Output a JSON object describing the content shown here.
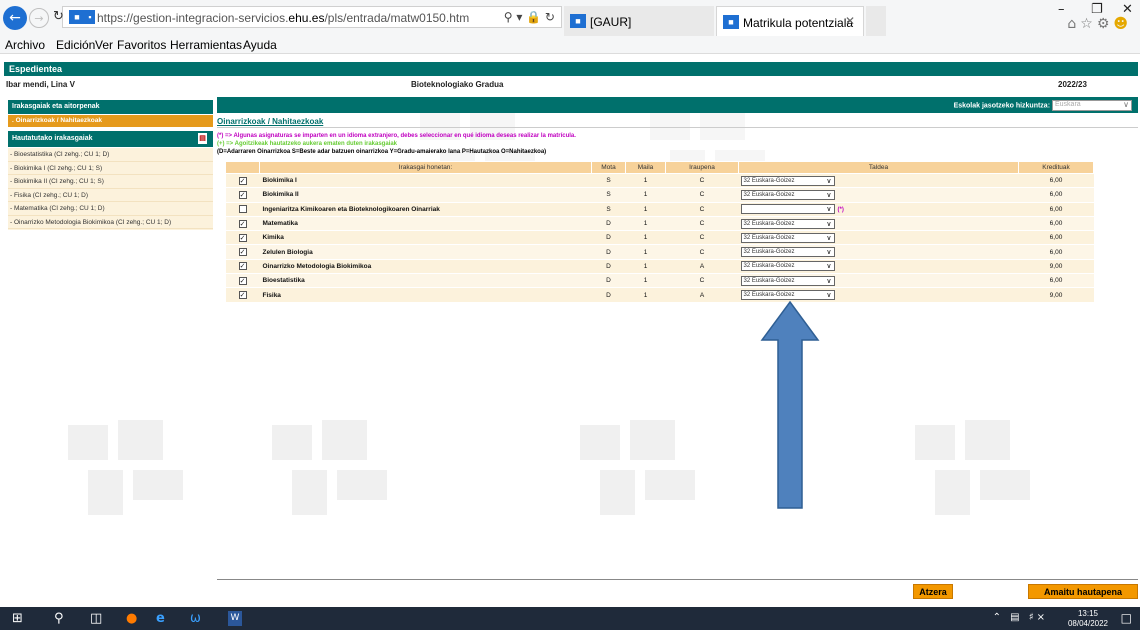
{
  "browser": {
    "url_prefix": "https://gestion-integracion-servicios.",
    "url_domain": "ehu.es",
    "url_suffix": "/pls/entrada/matw0150.htm",
    "tabs": [
      {
        "label": "[GAUR]"
      },
      {
        "label": "Matrikula potentziala"
      }
    ],
    "menu": [
      "Archivo",
      "Edición",
      "Ver",
      "Favoritos",
      "Herramientas",
      "Ayuda"
    ]
  },
  "header": {
    "title": "Espedientea",
    "student_name": "Ibar mendi, Lina V",
    "degree": "Bioteknologiako Gradua",
    "year": "2022/23"
  },
  "sidebar": {
    "section1_title": "Irakasgaiak eta aitorpenak",
    "active_item": ". Oinarrizkoak / Nahitaezkoak",
    "section2_title": "Hautatutako irakasgaiak",
    "items": [
      "- Bioestatistika (CI zehg.; CU 1; D)",
      "- Biokimika I (CI zehg.; CU 1; S)",
      "- Biokimika II (CI zehg.; CU 1; S)",
      "- Fisika (CI zehg.; CU 1; D)",
      "- Matematika (CI zehg.; CU 1; D)",
      "- Oinarrizko Metodologia Biokimikoa (CI zehg.; CU 1; D)"
    ]
  },
  "main": {
    "lang_label": "Eskolak jasotzeko hizkuntza:",
    "lang_value": "Euskara",
    "section_title": "Oinarrizkoak / Nahitaezkoak",
    "note1": "(*) => Algunas asignaturas se imparten en un idioma extranjero, debes seleccionar en qué idioma deseas realizar la matrícula.",
    "note2": "(+) => Agoitzikeak hautatzeko aukera ematen duten irakasgaiak",
    "note3": "(D=Adarraren Oinarrizkoa S=Beste adar batzuen oinarrizkoa Y=Gradu-amaierako lana P=Hautazkoa O=Nahitaezkoa)",
    "columns": [
      "Irakasgai honetan:",
      "Mota",
      "Maila",
      "Iraupena",
      "Taldea",
      "Kredituak"
    ],
    "rows": [
      {
        "checked": true,
        "name": "Biokimika I",
        "mota": "S",
        "maila": "1",
        "iraupena": "C",
        "taldea": "32 Euskara-Goizez",
        "kredituak": "6,00"
      },
      {
        "checked": true,
        "name": "Biokimika II",
        "mota": "S",
        "maila": "1",
        "iraupena": "C",
        "taldea": "32 Euskara-Goizez",
        "kredituak": "6,00"
      },
      {
        "checked": false,
        "name": "Ingeniaritza Kimikoaren eta Bioteknologikoaren Oinarriak",
        "mota": "S",
        "maila": "1",
        "iraupena": "C",
        "taldea": "",
        "kredituak": "6,00",
        "note": "(*)"
      },
      {
        "checked": true,
        "name": "Matematika",
        "mota": "D",
        "maila": "1",
        "iraupena": "C",
        "taldea": "32 Euskara-Goizez",
        "kredituak": "6,00"
      },
      {
        "checked": true,
        "name": "Kimika",
        "mota": "D",
        "maila": "1",
        "iraupena": "C",
        "taldea": "32 Euskara-Goizez",
        "kredituak": "6,00"
      },
      {
        "checked": true,
        "name": "Zelulen Biologia",
        "mota": "D",
        "maila": "1",
        "iraupena": "C",
        "taldea": "32 Euskara-Goizez",
        "kredituak": "6,00"
      },
      {
        "checked": true,
        "name": "Oinarrizko Metodologia Biokimikoa",
        "mota": "D",
        "maila": "1",
        "iraupena": "A",
        "taldea": "32 Euskara-Goizez",
        "kredituak": "9,00"
      },
      {
        "checked": true,
        "name": "Bioestatistika",
        "mota": "D",
        "maila": "1",
        "iraupena": "C",
        "taldea": "32 Euskara-Goizez",
        "kredituak": "6,00"
      },
      {
        "checked": true,
        "name": "Fisika",
        "mota": "D",
        "maila": "1",
        "iraupena": "A",
        "taldea": "32 Euskara-Goizez",
        "kredituak": "9,00"
      }
    ],
    "btn_back": "Atzera",
    "btn_finish": "Amaitu hautapena"
  },
  "taskbar": {
    "time": "13:15",
    "date": "08/04/2022"
  },
  "colors": {
    "teal": "#00706c",
    "orange": "#f39800",
    "row_bg": "#fcf2dc",
    "header_bg": "#f7d29a",
    "arrow": "#4f81bd"
  }
}
